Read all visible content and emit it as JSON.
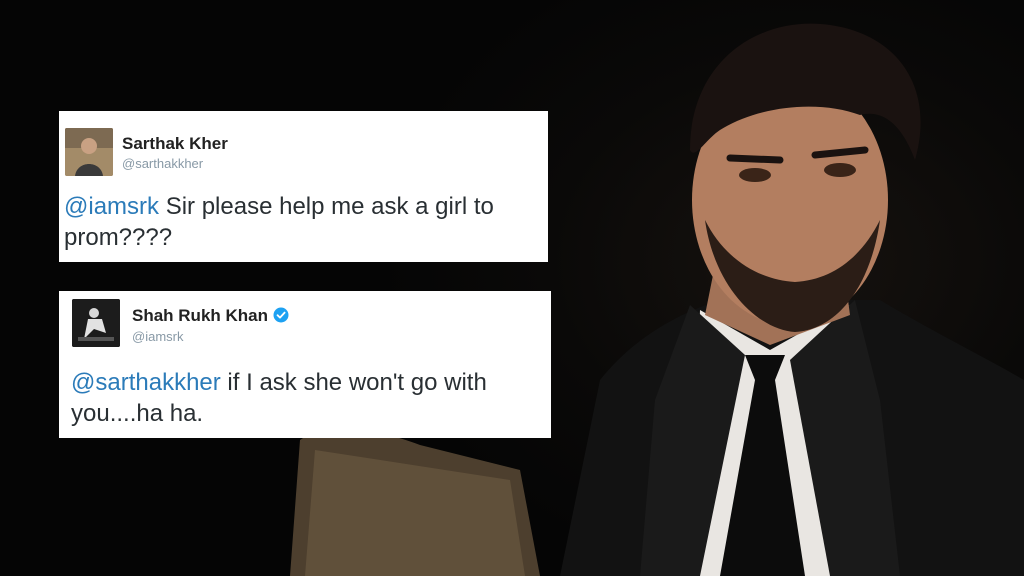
{
  "tweets": [
    {
      "display_name": "Sarthak Kher",
      "handle": "@sarthakkher",
      "mention": "@iamsrk",
      "line1_rest": " Sir please help me ask a girl to",
      "line2": "prom????",
      "verified": false
    },
    {
      "display_name": "Shah Rukh Khan",
      "handle": "@iamsrk",
      "mention": "@sarthakkher",
      "line1_rest": " if I ask she won't go with",
      "line2": "you....ha ha.",
      "verified": true
    }
  ],
  "colors": {
    "mention": "#2b7bb9",
    "verified_badge": "#1da1f2",
    "tweet_background": "#ffffff",
    "text": "#292f33",
    "handle": "#8899a6"
  },
  "icons": {
    "verified": "verified-badge-icon",
    "avatar_1": "user-avatar",
    "avatar_2": "user-avatar"
  }
}
